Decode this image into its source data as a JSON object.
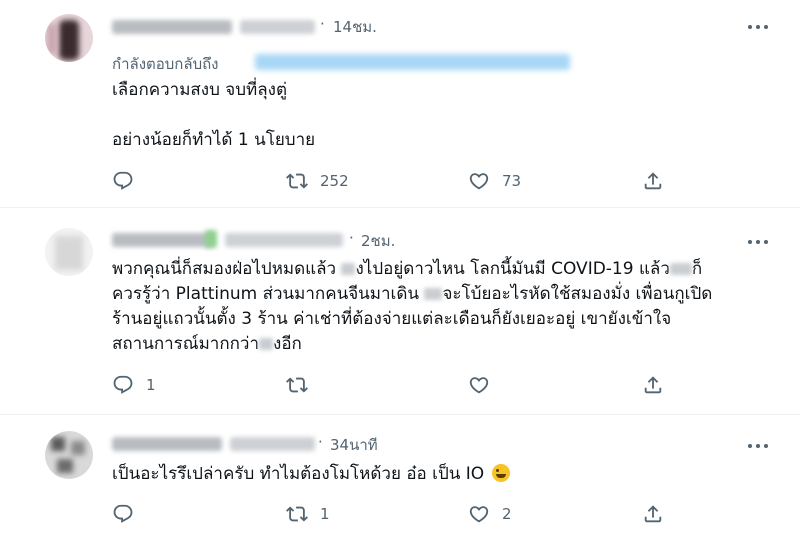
{
  "colors": {
    "text": "#0f1419",
    "secondary": "#536471",
    "divider": "#eff3f4",
    "link": "#1d9bf0"
  },
  "tweets": [
    {
      "dot": "·",
      "time": "14ชม.",
      "replying_label": "กำลังตอบกลับถึง",
      "text": "เลือกความสงบ จบที่ลุงตู่\n\nอย่างน้อยก็ทำได้ 1 นโยบาย",
      "actions": {
        "reply_count": "",
        "retweet_count": "252",
        "like_count": "73"
      }
    },
    {
      "dot": "·",
      "time": "2ชม.",
      "text_parts": [
        "พวกคุณนี่ก็สมองฝ่อไปหมดแล้ว ",
        "งไปอยู่ดาวไหน โลกนี้มันมี COVID-19 แล้ว",
        "ก็",
        "ควรรู้ว่า Plattinum ส่วนมากคนจีนมาเดิน ",
        "จะโบ้ยอะไรหัดใช้สมองมั่ง เพื่อนกูเปิด",
        "ร้านอยู่แถวนั้นตั้ง 3 ร้าน ค่าเช่าที่ต้องจ่ายแต่ละเดือนก็ยังเยอะอยู่ เขายังเข้าใจ",
        "สถานการณ์มากกว่า",
        "งอีก"
      ],
      "actions": {
        "reply_count": "1",
        "retweet_count": "",
        "like_count": ""
      }
    },
    {
      "dot": "·",
      "time": "34นาที",
      "text": "เป็นอะไรรึเปล่าครับ ทำไมต้องโมโหด้วย อ๋อ เป็น IO",
      "emoji": "rolling-on-floor-laughing-emoji",
      "actions": {
        "reply_count": "",
        "retweet_count": "1",
        "like_count": "2"
      }
    }
  ],
  "icons": [
    "reply-icon",
    "retweet-icon",
    "like-icon",
    "share-icon",
    "more-icon"
  ]
}
